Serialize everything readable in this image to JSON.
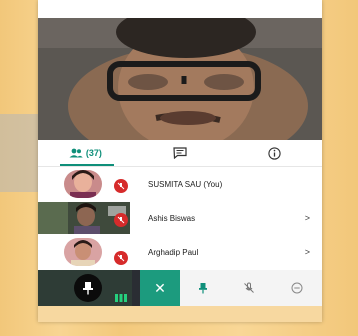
{
  "tabs": {
    "participants_count": "(37)",
    "chat_icon": "chat-icon",
    "info_icon": "info-icon"
  },
  "participants": [
    {
      "name": "SUSMITA SAU (You)",
      "muted": true,
      "has_chevron": false
    },
    {
      "name": "Ashis Biswas",
      "muted": true,
      "has_chevron": true
    },
    {
      "name": "Arghadip Paul",
      "muted": true,
      "has_chevron": true
    }
  ],
  "toolbar": {
    "close_glyph": "✕"
  },
  "colors": {
    "accent": "#0f8f7a",
    "muted_badge": "#d62b2b",
    "toolbar_bg": "#2a2d33"
  }
}
